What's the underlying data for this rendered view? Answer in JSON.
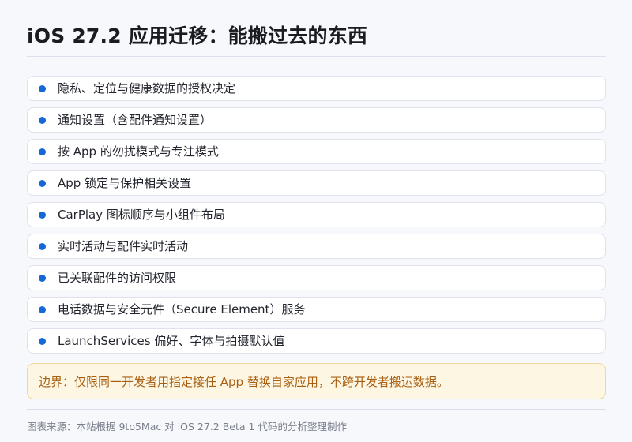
{
  "title": "iOS 27.2 应用迁移：能搬过去的东西",
  "accent_color": "#1668d6",
  "note_color": "#a85f12",
  "items": [
    {
      "label": "隐私、定位与健康数据的授权决定"
    },
    {
      "label": "通知设置（含配件通知设置）"
    },
    {
      "label": "按 App 的勿扰模式与专注模式"
    },
    {
      "label": "App 锁定与保护相关设置"
    },
    {
      "label": "CarPlay 图标顺序与小组件布局"
    },
    {
      "label": "实时活动与配件实时活动"
    },
    {
      "label": "已关联配件的访问权限"
    },
    {
      "label": "电话数据与安全元件（Secure Element）服务"
    },
    {
      "label": "LaunchServices 偏好、字体与拍摄默认值"
    }
  ],
  "note": "边界：仅限同一开发者用指定接任 App 替换自家应用，不跨开发者搬运数据。",
  "source": "图表来源：本站根据 9to5Mac 对 iOS 27.2 Beta 1 代码的分析整理制作"
}
